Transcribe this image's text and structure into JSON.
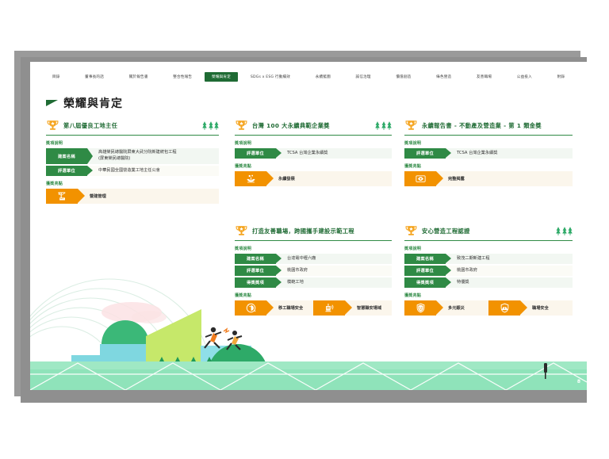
{
  "nav": {
    "items": [
      {
        "label": "目錄",
        "active": false
      },
      {
        "label": "董事長的話",
        "active": false
      },
      {
        "label": "關於報告書",
        "active": false
      },
      {
        "label": "整合性報告",
        "active": false
      },
      {
        "label": "榮耀與肯定",
        "active": true
      },
      {
        "label": "SDGs x ESG 行動績效",
        "active": false
      },
      {
        "label": "永續藍圖",
        "active": false
      },
      {
        "label": "誠信治理",
        "active": false
      },
      {
        "label": "價值創造",
        "active": false
      },
      {
        "label": "綠色營造",
        "active": false
      },
      {
        "label": "友善職場",
        "active": false
      },
      {
        "label": "公益投入",
        "active": false
      },
      {
        "label": "附錄",
        "active": false
      }
    ]
  },
  "page": {
    "title": "榮耀與肯定",
    "number": "8"
  },
  "labels": {
    "award_desc": "獎項說明",
    "award_highlight": "獲獎亮點"
  },
  "cards": [
    {
      "id": "card-excellent-site-supervisor",
      "title": "第八屆優良工地主任",
      "trees": 3,
      "rows": [
        {
          "tag": "建案名稱",
          "value_lines": [
            "高雄榮民總醫院屏東大武分院新建統包工程",
            "(屏東榮民總醫院)"
          ],
          "tall": true
        },
        {
          "tag": "評選單位",
          "value_lines": [
            "中華民國全國營造業工地主任公會"
          ],
          "tall": false
        }
      ],
      "highlights": [
        {
          "icon": "crane-icon",
          "label": "營建管理"
        }
      ]
    },
    {
      "id": "card-top100-sustainable-enterprise",
      "title": "台灣 100 大永續典範企業獎",
      "trees": 3,
      "rows": [
        {
          "tag": "評選單位",
          "value_lines": [
            "TCSA 台灣企業永續獎"
          ],
          "tall": false
        }
      ],
      "highlights": [
        {
          "icon": "sprout-icon",
          "label": "永續發展"
        }
      ]
    },
    {
      "id": "card-sustainability-report-gold",
      "title": "永續報告書 - 不動產及營造業 - 第 1 類金獎",
      "trees": 0,
      "rows": [
        {
          "tag": "評選單位",
          "value_lines": [
            "TCSA 台灣企業永續獎"
          ],
          "tall": false
        }
      ],
      "highlights": [
        {
          "icon": "eye-icon",
          "label": "完整揭露"
        }
      ]
    },
    {
      "id": "card-friendly-workplace-demo",
      "title": "打造友善職場，跨國攜手建設示範工程",
      "trees": 0,
      "rows": [
        {
          "tag": "建案名稱",
          "value_lines": [
            "台達電中壢六廠"
          ],
          "tall": false
        },
        {
          "tag": "評選單位",
          "value_lines": [
            "桃園市政府"
          ],
          "tall": false
        },
        {
          "tag": "得獎獎項",
          "value_lines": [
            "模範工地"
          ],
          "tall": false
        }
      ],
      "highlights": [
        {
          "icon": "migrant-safety-icon",
          "label": "移工職場安全"
        },
        {
          "icon": "smart-safety-icon",
          "label": "智慧職安場域"
        }
      ]
    },
    {
      "id": "card-safe-construction-certification",
      "title": "安心營造工程認證",
      "trees": 3,
      "rows": [
        {
          "tag": "建案名稱",
          "value_lines": [
            "致茂二期新建工程"
          ],
          "tall": false
        },
        {
          "tag": "評選單位",
          "value_lines": [
            "桃園市政府"
          ],
          "tall": false
        },
        {
          "tag": "得獎獎項",
          "value_lines": [
            "特優獎"
          ],
          "tall": false
        }
      ],
      "highlights": [
        {
          "icon": "shield-smile-icon",
          "label": "多元賑災"
        },
        {
          "icon": "helmet-icon",
          "label": "職場安全"
        }
      ]
    }
  ],
  "colors": {
    "brand_green": "#1f6b34",
    "accent_green": "#2f8a45",
    "orange": "#f29200",
    "light_green_bg": "#f2f7f2",
    "light_orange_bg": "#fbf6ec"
  }
}
